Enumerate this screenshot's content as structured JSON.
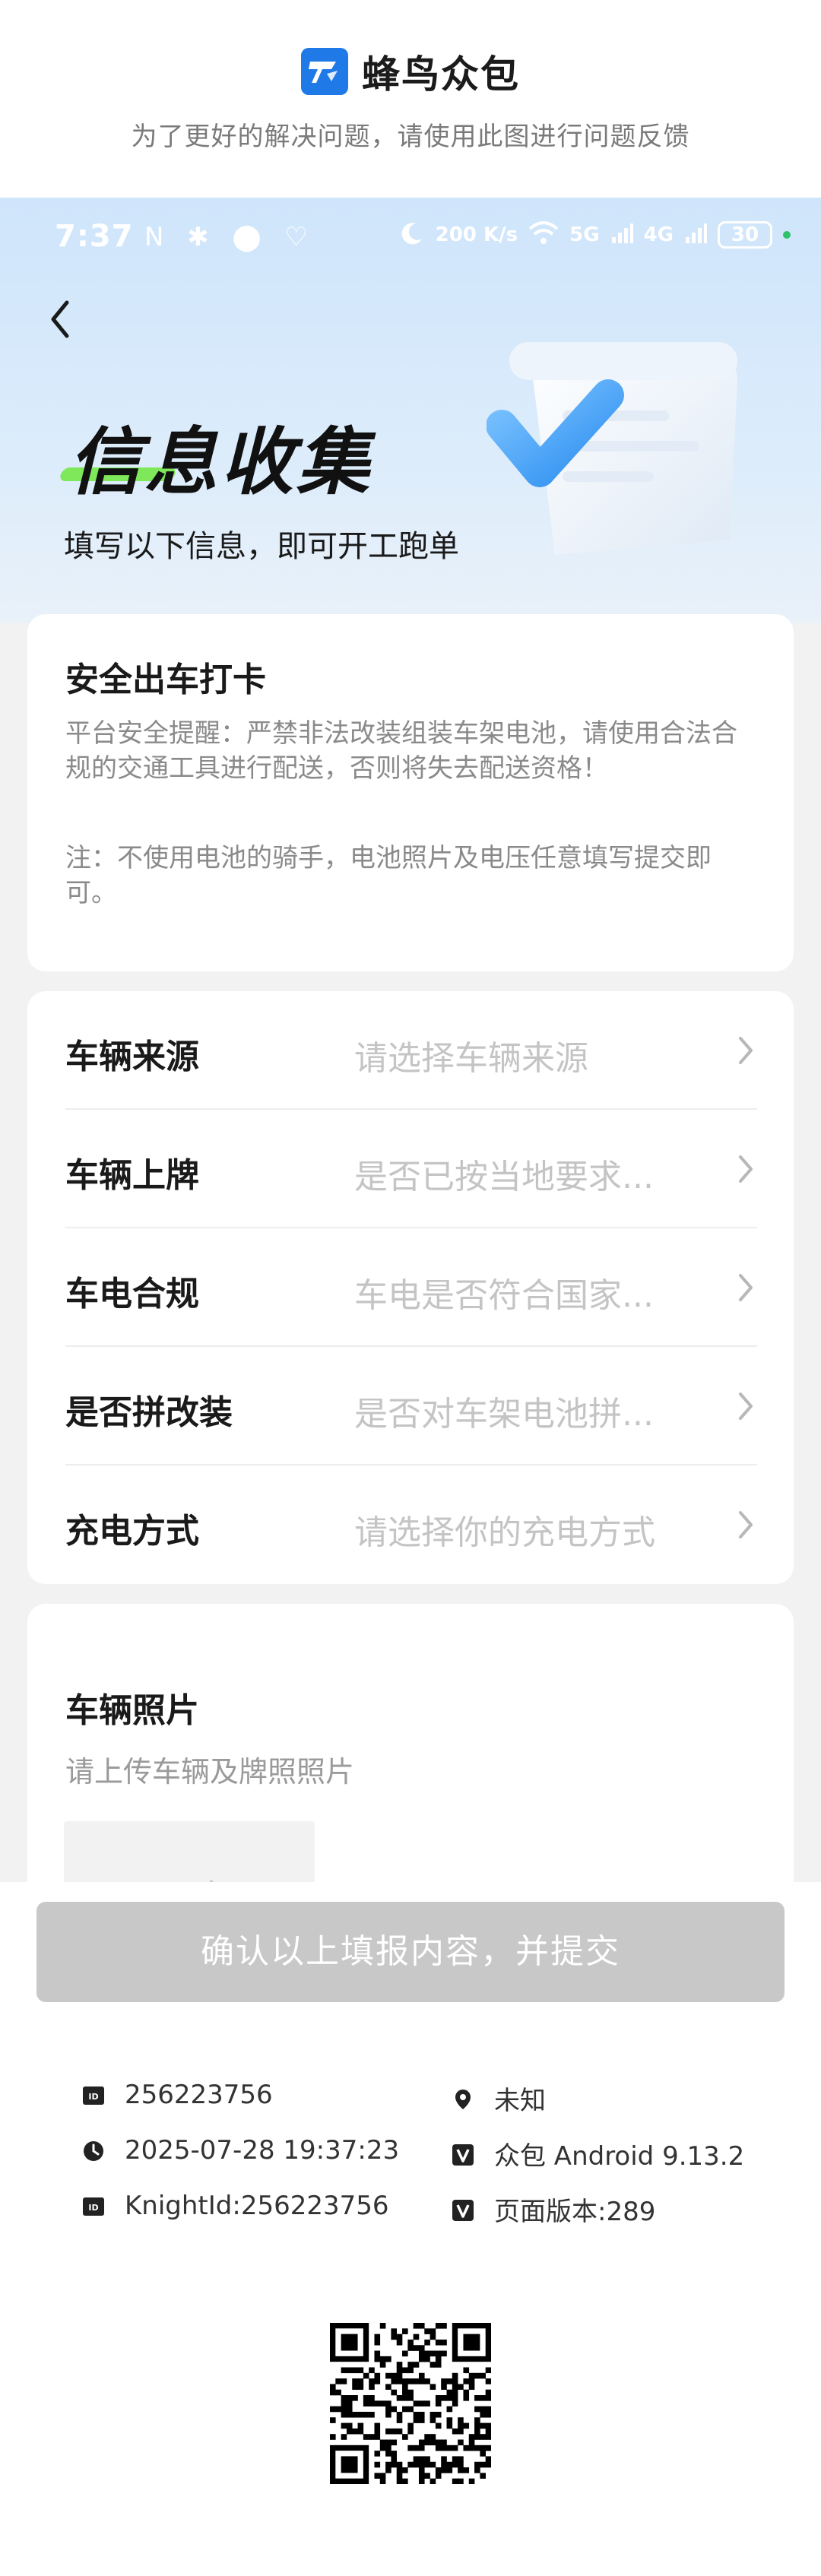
{
  "brand": {
    "title": "蜂鸟众包",
    "subtitle": "为了更好的解决问题，请使用此图进行问题反馈"
  },
  "status_bar": {
    "time": "7:37",
    "left_icons": "N ✱ ⬤ ♡",
    "speed": "200 K/s",
    "network_5g": "5G",
    "network_4g": "4G",
    "battery": "30"
  },
  "hero": {
    "title": "信息收集",
    "subtitle": "填写以下信息，即可开工跑单"
  },
  "safety": {
    "title": "安全出车打卡",
    "reminder": "平台安全提醒：严禁非法改装组装车架电池，请使用合法合规的交通工具进行配送，否则将失去配送资格！",
    "note": "注：不使用电池的骑手，电池照片及电压任意填写提交即可。"
  },
  "form": {
    "rows": [
      {
        "label": "车辆来源",
        "value": "请选择车辆来源"
      },
      {
        "label": "车辆上牌",
        "value": "是否已按当地要求..."
      },
      {
        "label": "车电合规",
        "value": "车电是否符合国家..."
      },
      {
        "label": "是否拼改装",
        "value": "是否对车架电池拼..."
      },
      {
        "label": "充电方式",
        "value": "请选择你的充电方式"
      }
    ]
  },
  "photo": {
    "title": "车辆照片",
    "subtitle": "请上传车辆及牌照照片"
  },
  "submit": {
    "label": "确认以上填报内容，并提交"
  },
  "footer": {
    "id": "256223756",
    "location": "未知",
    "datetime": "2025-07-28 19:37:23",
    "app_version": "众包 Android 9.13.2",
    "knight_id": "KnightId:256223756",
    "page_version": "页面版本:289"
  },
  "colors": {
    "brand_blue": "#1f7ae8",
    "accent_green": "#7ee85a",
    "disabled_button": "#c8c8c8"
  }
}
